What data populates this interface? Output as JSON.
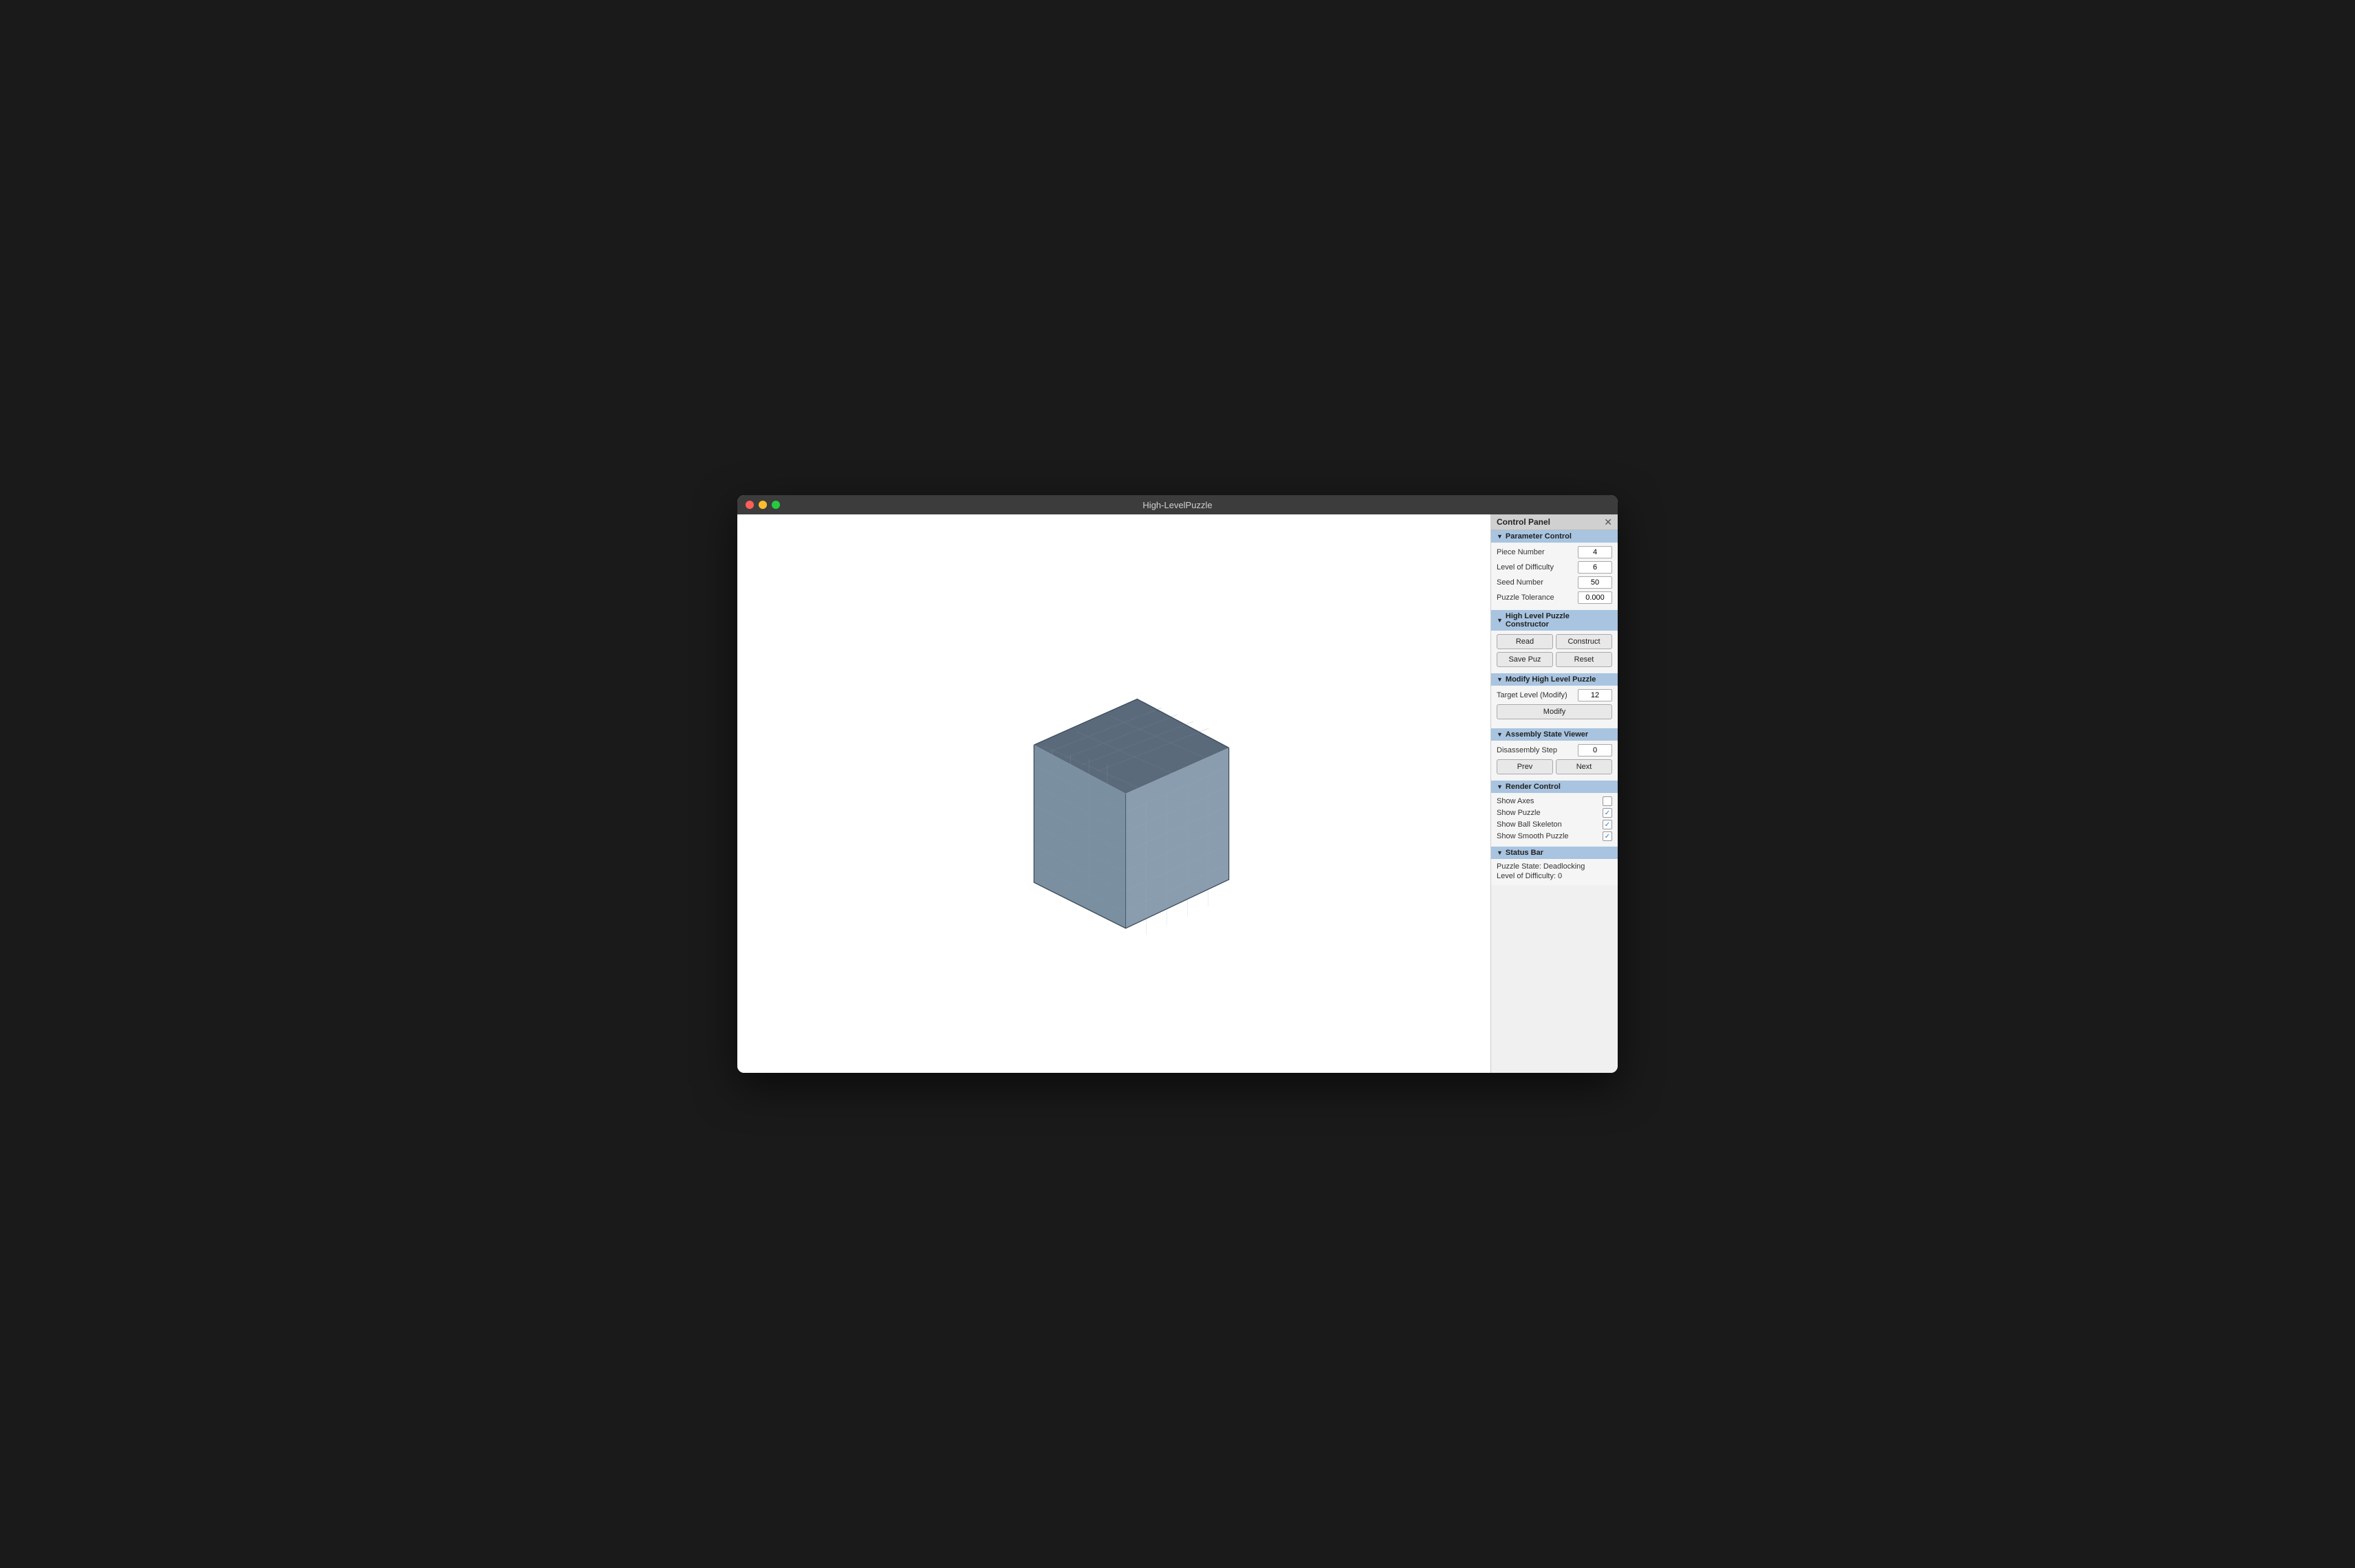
{
  "window": {
    "title": "High-LevelPuzzle"
  },
  "titlebar": {
    "close_label": "×",
    "minimize_label": "–",
    "maximize_label": "+"
  },
  "control_panel": {
    "header_label": "Control Panel",
    "close_icon": "✕",
    "sections": {
      "parameter_control": {
        "label": "Parameter Control",
        "fields": {
          "piece_number_label": "Piece Number",
          "piece_number_value": "4",
          "level_of_difficulty_label": "Level of Difficulty",
          "level_of_difficulty_value": "6",
          "seed_number_label": "Seed Number",
          "seed_number_value": "50",
          "puzzle_tolerance_label": "Puzzle Tolerance",
          "puzzle_tolerance_value": "0.000"
        }
      },
      "high_level_constructor": {
        "label": "High Level Puzzle Constructor",
        "buttons": {
          "read": "Read",
          "construct": "Construct",
          "save_puz": "Save Puz",
          "reset": "Reset"
        }
      },
      "modify": {
        "label": "Modify High Level Puzzle",
        "target_level_label": "Target Level (Modify)",
        "target_level_value": "12",
        "modify_button": "Modify"
      },
      "assembly_state": {
        "label": "Assembly State Viewer",
        "disassembly_step_label": "Disassembly Step",
        "disassembly_step_value": "0",
        "prev_button": "Prev",
        "next_button": "Next"
      },
      "render_control": {
        "label": "Render Control",
        "checkboxes": {
          "show_axes_label": "Show Axes",
          "show_axes_checked": false,
          "show_puzzle_label": "Show Puzzle",
          "show_puzzle_checked": true,
          "show_ball_skeleton_label": "Show Ball Skeleton",
          "show_ball_skeleton_checked": true,
          "show_smooth_puzzle_label": "Show Smooth Puzzle",
          "show_smooth_puzzle_checked": true
        }
      },
      "status_bar": {
        "label": "Status Bar",
        "puzzle_state": "Puzzle State: Deadlocking",
        "level_of_difficulty": "Level of Difficulty: 0"
      }
    }
  }
}
